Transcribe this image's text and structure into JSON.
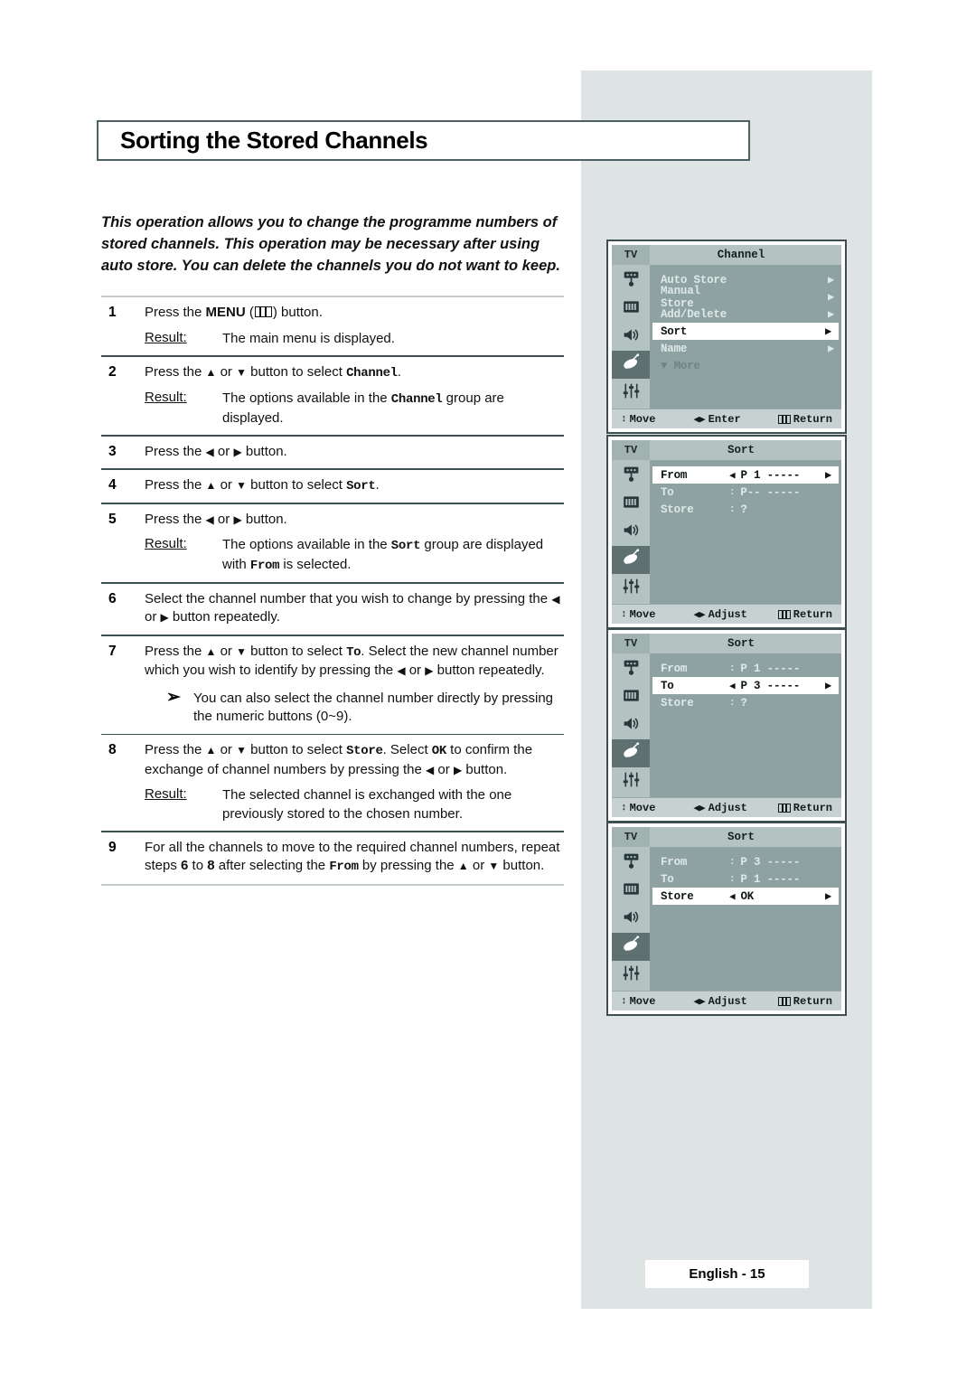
{
  "page": {
    "title": "Sorting the Stored Channels",
    "intro": "This operation allows you to change the programme numbers of stored channels. This operation may be necessary after using auto store. You can delete the channels you do not want to keep.",
    "footer": "English - 15"
  },
  "steps": [
    {
      "num": "1",
      "text_pre": "Press the ",
      "text_bold": "MENU",
      "text_post": " button.",
      "result_label": "Result:",
      "result_text": "The main menu is displayed."
    },
    {
      "num": "2",
      "text_a": "Press the ",
      "text_b": " or ",
      "text_c": " button to select ",
      "mono": "Channel",
      "text_d": ".",
      "result_label": "Result:",
      "result_a": "The options available in the ",
      "result_mono": "Channel",
      "result_b": " group are displayed."
    },
    {
      "num": "3",
      "text_a": "Press the ",
      "text_b": " or ",
      "text_c": " button."
    },
    {
      "num": "4",
      "text_a": "Press the ",
      "text_b": " or ",
      "text_c": " button to select ",
      "mono": "Sort",
      "text_d": "."
    },
    {
      "num": "5",
      "text_a": "Press the ",
      "text_b": " or ",
      "text_c": " button.",
      "result_label": "Result:",
      "result_a": "The options available in the ",
      "result_mono": "Sort",
      "result_b": " group are displayed with ",
      "result_mono2": "From",
      "result_c": " is selected."
    },
    {
      "num": "6",
      "text_a": "Select the channel number that you wish to change by pressing the ",
      "text_b": " or ",
      "text_c": " button repeatedly."
    },
    {
      "num": "7",
      "text_a": "Press the ",
      "text_b": " or ",
      "text_c": " button to select ",
      "mono": "To",
      "text_d": ". Select the new channel number which you wish to identify by pressing the ",
      "text_e": " or ",
      "text_f": " button repeatedly.",
      "note_mark": "➢",
      "note_text": "You can also select the channel number directly by pressing the numeric buttons (0~9)."
    },
    {
      "num": "8",
      "text_a": "Press the ",
      "text_b": " or ",
      "text_c": " button to select ",
      "mono": "Store",
      "text_d": ". Select ",
      "mono2": "OK",
      "text_e": " to confirm the exchange of channel numbers by pressing the ",
      "text_f": " or ",
      "text_g": " button.",
      "result_label": "Result:",
      "result_text": "The selected channel is exchanged with the one previously stored to the chosen number."
    },
    {
      "num": "9",
      "text_a": "For all the channels to move to the required channel numbers, repeat steps ",
      "bold_1": "6",
      "text_b": " to ",
      "bold_2": "8",
      "text_c": " after selecting the ",
      "mono": "From",
      "text_d": " by pressing the ",
      "text_e": " or ",
      "text_f": " button."
    }
  ],
  "osd_panels": [
    {
      "tv_label": "TV",
      "title": "Channel",
      "rows": [
        {
          "label": "Auto Store",
          "value": "",
          "caret_left": "",
          "caret_right": "▶",
          "selected": false,
          "muted": false
        },
        {
          "label": "Manual Store",
          "value": "",
          "caret_left": "",
          "caret_right": "▶",
          "selected": false,
          "muted": false
        },
        {
          "label": "Add/Delete",
          "value": "",
          "caret_left": "",
          "caret_right": "▶",
          "selected": false,
          "muted": false
        },
        {
          "label": "Sort",
          "value": "",
          "caret_left": "",
          "caret_right": "▶",
          "selected": true,
          "muted": false
        },
        {
          "label": "Name",
          "value": "",
          "caret_left": "",
          "caret_right": "▶",
          "selected": false,
          "muted": false
        },
        {
          "label": "▼ More",
          "value": "",
          "caret_left": "",
          "caret_right": "",
          "selected": false,
          "muted": true
        }
      ],
      "footer": {
        "move": "Move",
        "middle": "Enter",
        "return": "Return"
      }
    },
    {
      "tv_label": "TV",
      "title": "Sort",
      "rows": [
        {
          "label": "From",
          "value": "P 1 -----",
          "caret_left": "◀",
          "caret_right": "▶",
          "selected": true,
          "muted": false
        },
        {
          "label": "To",
          "value": "P-- -----",
          "caret_left": ":",
          "caret_right": "",
          "selected": false,
          "muted": false
        },
        {
          "label": "Store",
          "value": "?",
          "caret_left": ":",
          "caret_right": "",
          "selected": false,
          "muted": false
        }
      ],
      "footer": {
        "move": "Move",
        "middle": "Adjust",
        "return": "Return"
      }
    },
    {
      "tv_label": "TV",
      "title": "Sort",
      "rows": [
        {
          "label": "From",
          "value": "P 1 -----",
          "caret_left": ":",
          "caret_right": "",
          "selected": false,
          "muted": false
        },
        {
          "label": "To",
          "value": "P 3 -----",
          "caret_left": "◀",
          "caret_right": "▶",
          "selected": true,
          "muted": false
        },
        {
          "label": "Store",
          "value": "?",
          "caret_left": ":",
          "caret_right": "",
          "selected": false,
          "muted": false
        }
      ],
      "footer": {
        "move": "Move",
        "middle": "Adjust",
        "return": "Return"
      }
    },
    {
      "tv_label": "TV",
      "title": "Sort",
      "rows": [
        {
          "label": "From",
          "value": "P 3 -----",
          "caret_left": ":",
          "caret_right": "",
          "selected": false,
          "muted": false
        },
        {
          "label": "To",
          "value": "P 1 -----",
          "caret_left": ":",
          "caret_right": "",
          "selected": false,
          "muted": false
        },
        {
          "label": "Store",
          "value": "OK",
          "caret_left": "◀",
          "caret_right": "▶",
          "selected": true,
          "muted": false
        }
      ],
      "footer": {
        "move": "Move",
        "middle": "Adjust",
        "return": "Return"
      }
    }
  ],
  "icons": {
    "rail": [
      "tuner-icon",
      "picture-icon",
      "speaker-icon",
      "satellite-dish-icon",
      "equalizer-icon"
    ],
    "selected_rail_index": 3
  },
  "colors": {
    "panel_grey": "#dee3e3",
    "osd_body": "#8fa2a2",
    "osd_header": "#b5c2c2",
    "osd_footer": "#c7d1d1",
    "border": "#3e4f52"
  }
}
